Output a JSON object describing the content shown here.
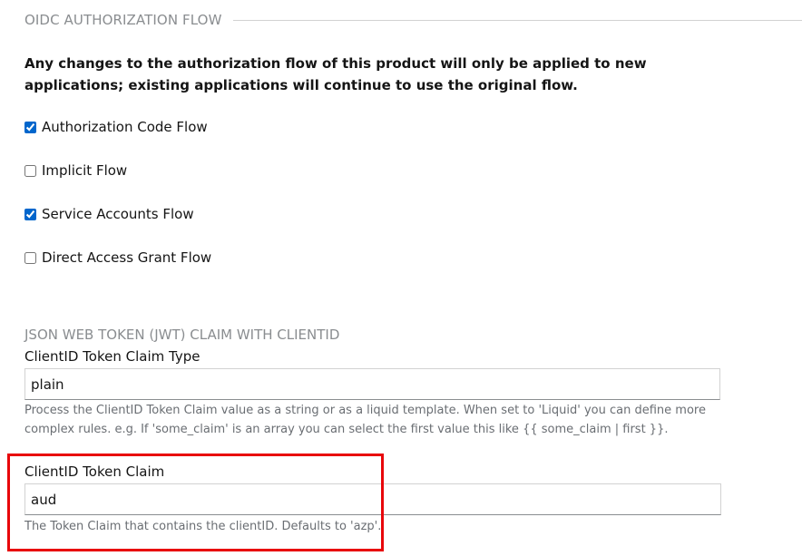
{
  "oidc_section": {
    "legend": "OIDC AUTHORIZATION FLOW",
    "notice": "Any changes to the authorization flow of this product will only be applied to new applications; existing applications will continue to use the original flow.",
    "flows": [
      {
        "label": "Authorization Code Flow",
        "checked": true
      },
      {
        "label": "Implicit Flow",
        "checked": false
      },
      {
        "label": "Service Accounts Flow",
        "checked": true
      },
      {
        "label": "Direct Access Grant Flow",
        "checked": false
      }
    ]
  },
  "jwt_section": {
    "title": "JSON WEB TOKEN (JWT) CLAIM WITH CLIENTID",
    "claim_type": {
      "label": "ClientID Token Claim Type",
      "value": "plain",
      "help": "Process the ClientID Token Claim value as a string or as a liquid template. When set to 'Liquid' you can define more complex rules. e.g. If 'some_claim' is an array you can select the first value this like {{ some_claim | first }}."
    },
    "claim": {
      "label": "ClientID Token Claim",
      "value": "aud",
      "help": "The Token Claim that contains the clientID. Defaults to 'azp'."
    }
  },
  "colors": {
    "highlight": "#e8070b",
    "checkbox_accent": "#0066cc"
  }
}
